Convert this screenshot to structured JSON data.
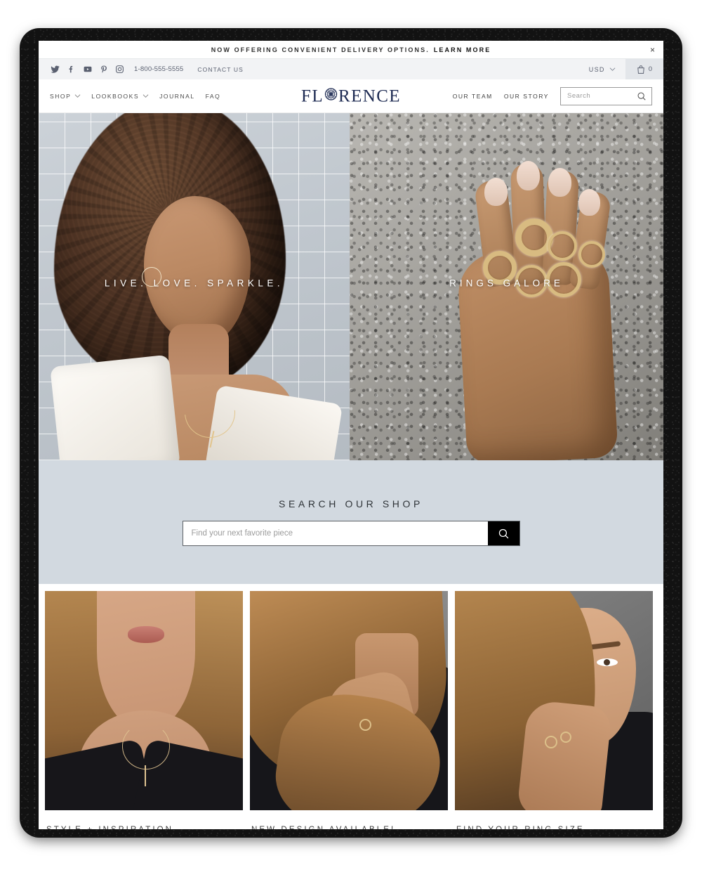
{
  "announcement": {
    "text": "NOW OFFERING CONVENIENT DELIVERY OPTIONS.",
    "link_label": "LEARN MORE",
    "close_label": "×"
  },
  "utility_bar": {
    "social": [
      {
        "name": "twitter-icon",
        "label": "Twitter"
      },
      {
        "name": "facebook-icon",
        "label": "Facebook"
      },
      {
        "name": "youtube-icon",
        "label": "YouTube"
      },
      {
        "name": "pinterest-icon",
        "label": "Pinterest"
      },
      {
        "name": "instagram-icon",
        "label": "Instagram"
      }
    ],
    "phone": "1-800-555-5555",
    "contact_label": "CONTACT US",
    "currency": "USD",
    "cart_count": "0"
  },
  "nav": {
    "left_items": [
      {
        "label": "SHOP",
        "has_caret": true
      },
      {
        "label": "LOOKBOOKS",
        "has_caret": true
      },
      {
        "label": "JOURNAL",
        "has_caret": false
      },
      {
        "label": "FAQ",
        "has_caret": false
      }
    ],
    "logo": {
      "before": "FL",
      "after": "RENCE",
      "gem_icon": "rosette-gem-icon"
    },
    "right_items": [
      {
        "label": "OUR TEAM"
      },
      {
        "label": "OUR STORY"
      }
    ],
    "search_placeholder": "Search"
  },
  "hero": {
    "slides": [
      {
        "caption": "LIVE. LOVE. SPARKLE.",
        "alt": "woman-with-curly-hair-wearing-hoop-earring-and-necklace"
      },
      {
        "caption": "RINGS GALORE",
        "alt": "hand-with-gold-rings-against-concrete"
      }
    ]
  },
  "search_shop": {
    "title": "SEARCH OUR SHOP",
    "placeholder": "Find your next favorite piece",
    "value": "",
    "button_icon": "search-icon"
  },
  "cards": [
    {
      "caption": "STYLE + INSPIRATION",
      "alt": "woman-wearing-delicate-pendant-necklace"
    },
    {
      "caption": "NEW DESIGN AVAILABLE!",
      "alt": "woman-touching-hair-wearing-ring"
    },
    {
      "caption": "FIND YOUR RING SIZE",
      "alt": "woman-in-profile-wearing-rings"
    }
  ],
  "colors": {
    "brand_navy": "#1d2a52",
    "utility_bg": "#f2f3f5",
    "search_band_bg": "#d2d9e0",
    "accent_black": "#000000",
    "frame": "#121212"
  }
}
